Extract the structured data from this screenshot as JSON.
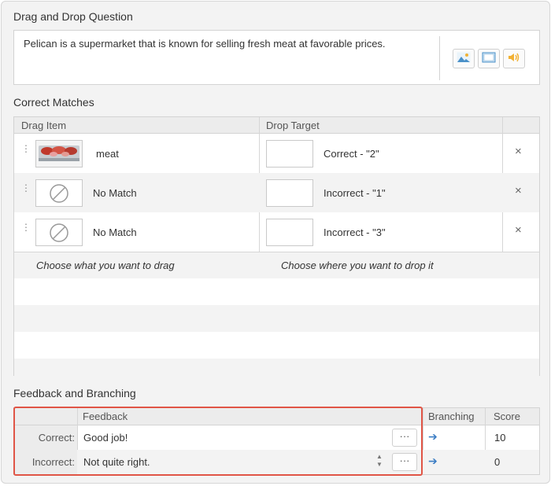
{
  "question": {
    "title": "Drag and Drop Question",
    "text": "Pelican is a supermarket that is known for selling fresh meat at favorable prices.",
    "media_buttons": [
      {
        "icon": "image-icon"
      },
      {
        "icon": "video-icon"
      },
      {
        "icon": "audio-icon"
      }
    ]
  },
  "matches": {
    "title": "Correct Matches",
    "col_drag": "Drag Item",
    "col_target": "Drop Target",
    "rows": [
      {
        "drag_label": "meat",
        "drag_icon": "meat-image",
        "target_label": "Correct - \"2\""
      },
      {
        "drag_label": "No Match",
        "drag_icon": "no-symbol-icon",
        "target_label": "Incorrect - \"1\""
      },
      {
        "drag_label": "No Match",
        "drag_icon": "no-symbol-icon",
        "target_label": "Incorrect - \"3\""
      }
    ],
    "choose_drag": "Choose what you want to drag",
    "choose_drop": "Choose where you want to drop it",
    "remove_glyph": "×"
  },
  "feedback": {
    "title": "Feedback and Branching",
    "col_feedback": "Feedback",
    "col_branching": "Branching",
    "col_score": "Score",
    "rows": [
      {
        "label": "Correct:",
        "text": "Good job!",
        "score": "10"
      },
      {
        "label": "Incorrect:",
        "text": "Not quite right.",
        "score": "0"
      }
    ],
    "dots": "···",
    "arrow": "➔"
  },
  "colors": {
    "highlight": "#e05546",
    "arrow": "#3b7dc4"
  }
}
